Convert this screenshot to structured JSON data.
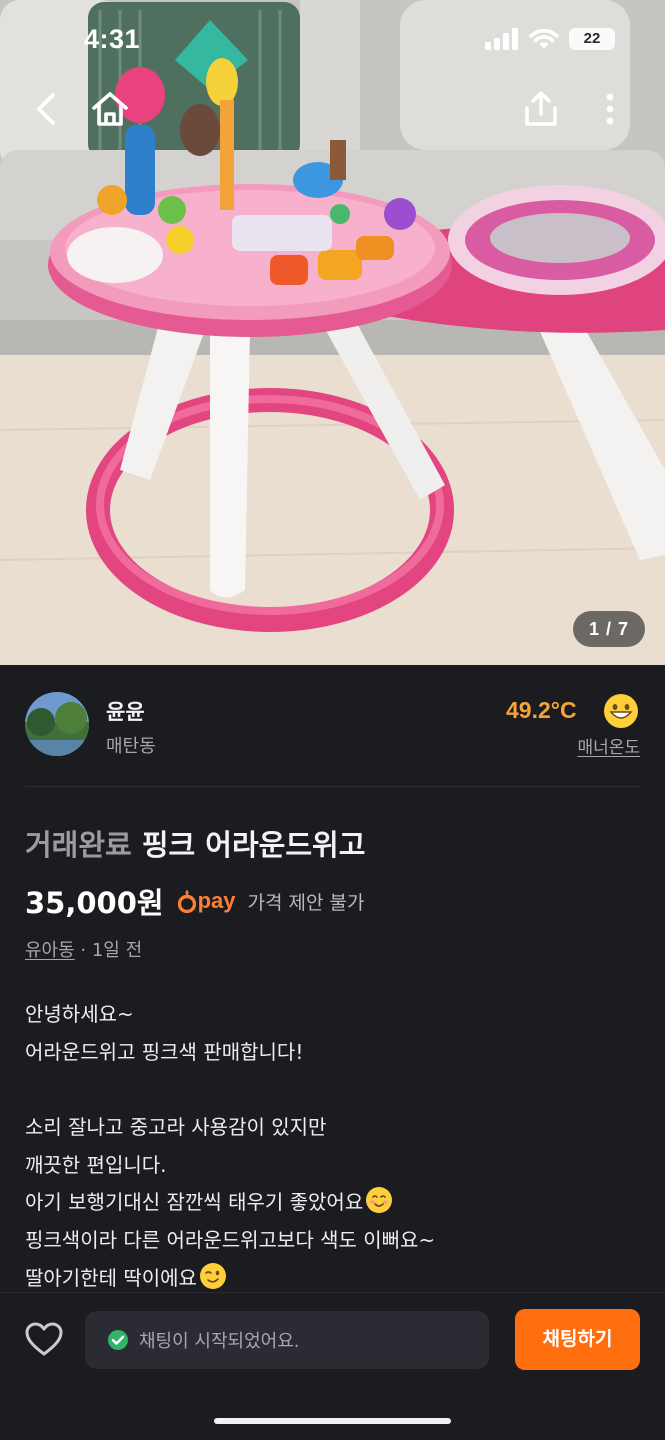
{
  "status_bar": {
    "time": "4:31",
    "battery": "22",
    "icons": [
      "signal-icon",
      "wifi-icon",
      "battery-icon"
    ]
  },
  "nav": {
    "back_icon": "back-arrow-icon",
    "home_icon": "home-icon",
    "share_icon": "share-icon",
    "more_icon": "more-vertical-icon"
  },
  "photo": {
    "counter": "1 / 7"
  },
  "seller": {
    "name": "윤윤",
    "location": "매탄동",
    "temperature": "49.2°C",
    "temperature_label": "매너온도",
    "temperature_color": "#f7a23a"
  },
  "product": {
    "status_word": "거래완료",
    "title": "핑크 어라운드위고",
    "price": "35,000원",
    "pay_label": "pay",
    "negotiation": "가격 제안 불가",
    "category": "유아동",
    "posted": " · 1일 전",
    "description": [
      "안녕하세요~",
      "어라운드위고 핑크색 판매합니다!",
      "",
      "소리 잘나고 중고라 사용감이 있지만",
      "깨끗한 편입니다.",
      "아기 보행기대신 잠깐씩 태우기 좋았어요",
      "핑크색이라 다른 어라운드위고보다 색도 이뻐요~",
      "딸아기한테 딱이에요"
    ]
  },
  "bottom_bar": {
    "chat_status": "채팅이 시작되었어요.",
    "chat_button": "채팅하기",
    "accent_color": "#ff6f0f"
  }
}
